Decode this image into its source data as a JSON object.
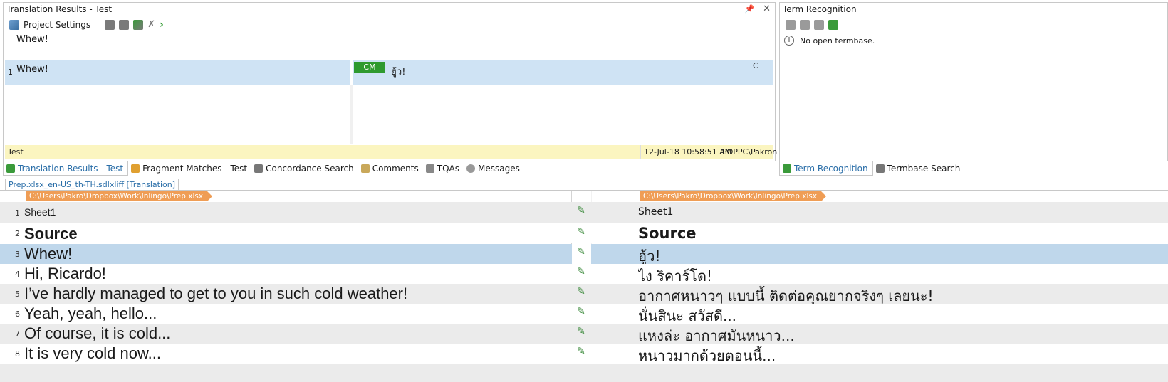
{
  "translation_results": {
    "title": "Translation Results - Test",
    "pin_icon": "pin-icon",
    "close_icon": "close-icon",
    "toolbar": {
      "project_settings_label": "Project Settings"
    },
    "source_preview": "Whew!",
    "match": {
      "row_number": "1",
      "source": "Whew!",
      "badge": "CM",
      "target": "ฮู้ว!",
      "flag": "C"
    },
    "status_bar": {
      "name": "Test",
      "date": "12-Jul-18 10:58:51 AM",
      "user": "POPPC\\Pakron"
    },
    "tabs": [
      {
        "label": "Translation Results - Test"
      },
      {
        "label": "Fragment Matches - Test"
      },
      {
        "label": "Concordance Search"
      },
      {
        "label": "Comments"
      },
      {
        "label": "TQAs"
      },
      {
        "label": "Messages"
      }
    ]
  },
  "term_recognition": {
    "title": "Term Recognition",
    "message": "No open termbase.",
    "tabs": [
      {
        "label": "Term Recognition"
      },
      {
        "label": "Termbase Search"
      }
    ]
  },
  "editor": {
    "document_tab": "Prep.xlsx_en-US_th-TH.sdlxliff [Translation]",
    "source_path": "C:\\Users\\Pakro\\Dropbox\\Work\\Inlingo\\Prep.xlsx",
    "target_path": "C:\\Users\\Pakro\\Dropbox\\Work\\Inlingo\\Prep.xlsx",
    "rows": [
      {
        "num": "1",
        "source": "Sheet1",
        "target": "Sheet1"
      },
      {
        "num": "2",
        "source": "Source",
        "target": "Source"
      },
      {
        "num": "3",
        "source": "Whew!",
        "target": "ฮู้ว!"
      },
      {
        "num": "4",
        "source": "Hi, Ricardo!",
        "target": "ไง ริคาร์โด!"
      },
      {
        "num": "5",
        "source": "I’ve hardly managed to get to you in such cold weather!",
        "target": "อากาศหนาวๆ แบบนี้ ติดต่อคุณยากจริงๆ เลยนะ!"
      },
      {
        "num": "6",
        "source": "Yeah, yeah, hello...",
        "target": "นั่นสินะ สวัสดี..."
      },
      {
        "num": "7",
        "source": "Of course, it is cold...",
        "target": "แหงล่ะ อากาศมันหนาว..."
      },
      {
        "num": "8",
        "source": "It is very cold now...",
        "target": "หนาวมากด้วยตอนนี้..."
      }
    ]
  },
  "colors": {
    "accent_blue": "#2a6ea8",
    "selected_row": "#bfd7eb",
    "match_row": "#cfe3f4",
    "badge_green": "#2f9a2f",
    "status_yellow": "#fbf5c0",
    "path_orange": "#ef9d55"
  }
}
